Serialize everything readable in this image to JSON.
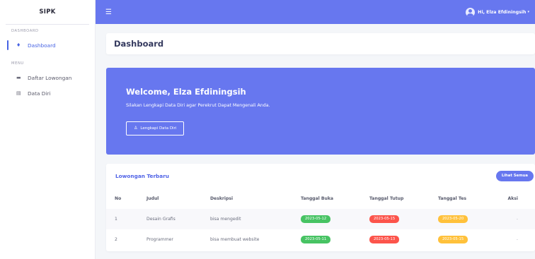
{
  "sidebar": {
    "brand": "SIPK",
    "sections": [
      {
        "title": "DASHBOARD",
        "items": [
          {
            "label": "Dashboard",
            "icon": "fire-icon",
            "active": true
          }
        ]
      },
      {
        "title": "MENU",
        "items": [
          {
            "label": "Daftar Lowongan",
            "icon": "inbox-icon",
            "active": false
          },
          {
            "label": "Data Diri",
            "icon": "id-card-icon",
            "active": false
          }
        ]
      }
    ]
  },
  "topbar": {
    "menu_icon": "hamburger-icon",
    "user_greeting": "Hi, Elza Efdiningsih"
  },
  "page_title": "Dashboard",
  "hero": {
    "title": "Welcome, Elza Efdiningsih",
    "subtitle": "Silakan Lengkapi Data Diri agar Perekrut Dapat Mengenali Anda.",
    "button_label": "Lengkapi Data Diri",
    "button_icon": "user-icon"
  },
  "vacancies": {
    "title": "Lowongan Terbaru",
    "view_all_label": "Lihat Semua",
    "columns": [
      "No",
      "Judul",
      "Deskripsi",
      "Tanggal Buka",
      "Tanggal Tutup",
      "Tanggal Tes",
      "Aksi"
    ],
    "rows": [
      {
        "no": "1",
        "judul": "Desain Grafis",
        "deskripsi": "bisa mengedit",
        "tanggal_buka": "2023-05-12",
        "tanggal_tutup": "2023-05-15",
        "tanggal_tes": "2023-05-20",
        "aksi": "-"
      },
      {
        "no": "2",
        "judul": "Programmer",
        "deskripsi": "bisa membuat website",
        "tanggal_buka": "2023-05-11",
        "tanggal_tutup": "2023-05-13",
        "tanggal_tes": "2023-05-15",
        "aksi": "-"
      }
    ]
  },
  "colors": {
    "primary": "#6777ef",
    "open_badge": "#47c363",
    "close_badge": "#fc544b",
    "test_badge": "#ffc13b"
  }
}
